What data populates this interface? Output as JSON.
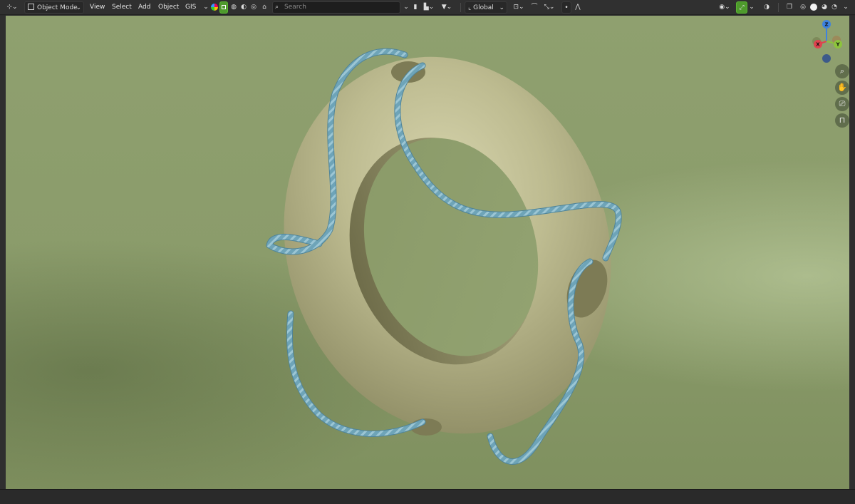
{
  "header": {
    "editor_type_icon": "axes-icon",
    "mode_label": "Object Mode",
    "menus": [
      "View",
      "Select",
      "Add",
      "Object",
      "GIS"
    ],
    "search_placeholder": "Search",
    "transform_orientation": "Global"
  },
  "colors": {
    "header_bg": "#303030",
    "viewport_bg": "#8b9c6b",
    "ring": "#b9b78c",
    "rope": "#6ea4b8",
    "accent_green": "#4e9a2c",
    "gizmo_x": "#e0424f",
    "gizmo_y": "#8cc43c",
    "gizmo_z": "#3d82e0"
  },
  "gizmo": {
    "x_label": "X",
    "y_label": "Y",
    "z_label": "Z"
  },
  "navigation": {
    "zoom_icon": "zoom-icon",
    "pan_icon": "hand-icon",
    "camera_icon": "camera-icon",
    "lock_icon": "lock-icon"
  }
}
